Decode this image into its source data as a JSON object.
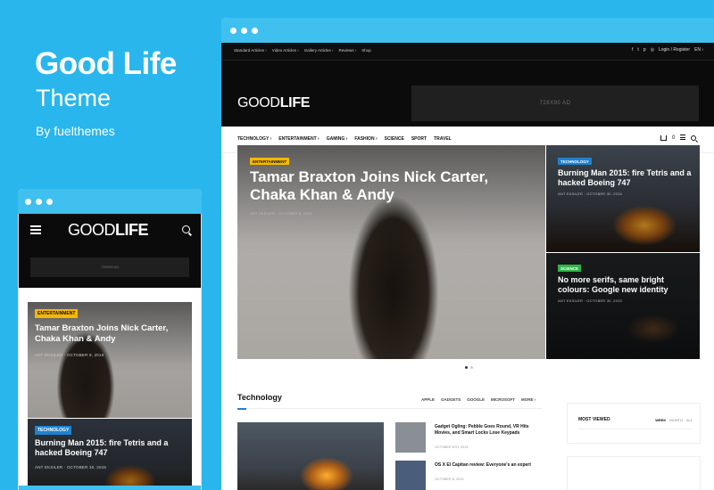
{
  "brand": {
    "title": "Good Life",
    "subtitle": "Theme",
    "by": "By fuelthemes"
  },
  "mobile": {
    "logo_a": "GOOD",
    "logo_b": "LIFE",
    "ad_label": "728X90 AD",
    "hero": {
      "tag": "ENTERTAINMENT",
      "title": "Tamar Braxton Joins Nick Carter, Chaka Khan & Andy",
      "meta": "ANT EKSILER  ·  OCTOBER 8, 2016"
    },
    "card2": {
      "tag": "TECHNOLOGY",
      "title": "Burning Man 2015: fire Tetris and a hacked Boeing 747",
      "meta": "ANT EKSILER  ·  OCTOBER 30, 2015"
    }
  },
  "desktop": {
    "topbar": {
      "links": [
        "Standard Articles ›",
        "Video Articles ›",
        "Gallery Articles ›",
        "Reviews ›",
        "Shop"
      ],
      "social": [
        "f",
        "t",
        "p",
        "◎"
      ],
      "login": "Login / Register",
      "lang": "EN ›"
    },
    "logo_a": "GOOD",
    "logo_b": "LIFE",
    "ad_label": "728X90 AD",
    "nav": {
      "items": [
        "TECHNOLOGY ›",
        "ENTERTAINMENT ›",
        "GAMING ›",
        "FASHION ›",
        "SCIENCE",
        "SPORT",
        "TRAVEL"
      ],
      "cart_count": "0"
    },
    "hero": {
      "tag": "ENTERTAINMENT",
      "title": "Tamar Braxton Joins Nick Carter, Chaka Khan & Andy",
      "meta": "ANT EKSILER  ·  OCTOBER 8, 2016"
    },
    "side1": {
      "tag": "TECHNOLOGY",
      "title": "Burning Man 2015: fire Tetris and a hacked Boeing 747",
      "meta": "ANT EKSILER  ·  OCTOBER 30, 2015"
    },
    "side2": {
      "tag": "SCIENCE",
      "title": "No more serifs, same bright colours: Google new identity",
      "meta": "ANT EKSILER  ·  OCTOBER 30, 2015"
    },
    "section": {
      "title": "Technology",
      "tabs": [
        "APPLE",
        "GADGETS",
        "GOOGLE",
        "MICROSOFT",
        "MORE ›"
      ]
    },
    "list": [
      {
        "title": "Gadget Ogling: Pebble Goes Round, VR Hits Movies, and Smart Locks Lose Keypads",
        "date": "OCTOBER 8TH, 2015"
      },
      {
        "title": "OS X El Capitan review: Everyone's an expert",
        "date": "OCTOBER 8, 2015"
      }
    ],
    "widget": {
      "title": "MOST VIEWED",
      "tabs": [
        "WEEK",
        "MONTH",
        "ALL"
      ]
    }
  }
}
